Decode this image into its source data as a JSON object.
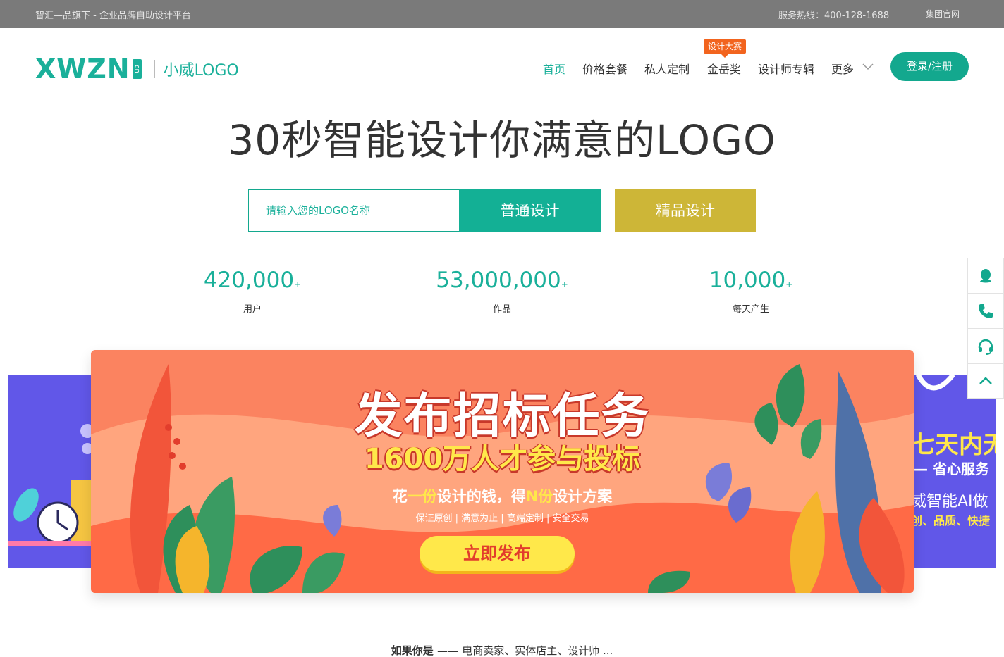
{
  "topbar": {
    "left_text": "智汇—品旗下 - 企业品牌自助设计平台",
    "hotline": "服务热线：400-128-1688",
    "group_site": "集团官网"
  },
  "header": {
    "logo_text": "XWZN",
    "logo_cn": "cn",
    "logo_sub": "小威LOGO",
    "nav": [
      {
        "label": "首页",
        "active": true
      },
      {
        "label": "价格套餐"
      },
      {
        "label": "私人定制"
      },
      {
        "label": "金岳奖"
      },
      {
        "label": "设计师专辑"
      },
      {
        "label": "更多"
      }
    ],
    "badge": "设计大赛",
    "login": "登录/注册"
  },
  "hero": {
    "title": "30秒智能设计你满意的LOGO",
    "search_placeholder": "请输入您的LOGO名称",
    "btn_normal": "普通设计",
    "btn_premium": "精品设计"
  },
  "stats": [
    {
      "value": "420,000",
      "suffix": "+",
      "label": "用户"
    },
    {
      "value": "53,000,000",
      "suffix": "+",
      "label": "作品"
    },
    {
      "value": "10,000",
      "suffix": "+",
      "label": "每天产生"
    }
  ],
  "banner": {
    "title": "发布招标任务",
    "subtitle": "1600万人才参与投标",
    "tagline_a": "花",
    "tagline_b": "一份",
    "tagline_c": "设计的钱，得",
    "tagline_d": "N份",
    "tagline_e": "设计方案",
    "features": "保证原创 | 满意为止 | 高端定制 | 安全交易",
    "cta": "立即发布"
  },
  "next_slide": {
    "line1": "七天内无",
    "line2": "— 省心服务",
    "line3": "威智能AI做",
    "line4": "创、品质、快捷"
  },
  "bottom": {
    "lead": "如果你是 —— ",
    "rest": "电商卖家、实体店主、设计师 ..."
  },
  "colors": {
    "brand": "#13a88e",
    "premium": "#cdb637",
    "badge": "#f2641e",
    "banner_bg": "#fb8360",
    "side_slide": "#6157e8"
  },
  "icons": {
    "sidebar": [
      "qq-icon",
      "phone-icon",
      "headset-icon",
      "back-to-top-icon"
    ]
  }
}
